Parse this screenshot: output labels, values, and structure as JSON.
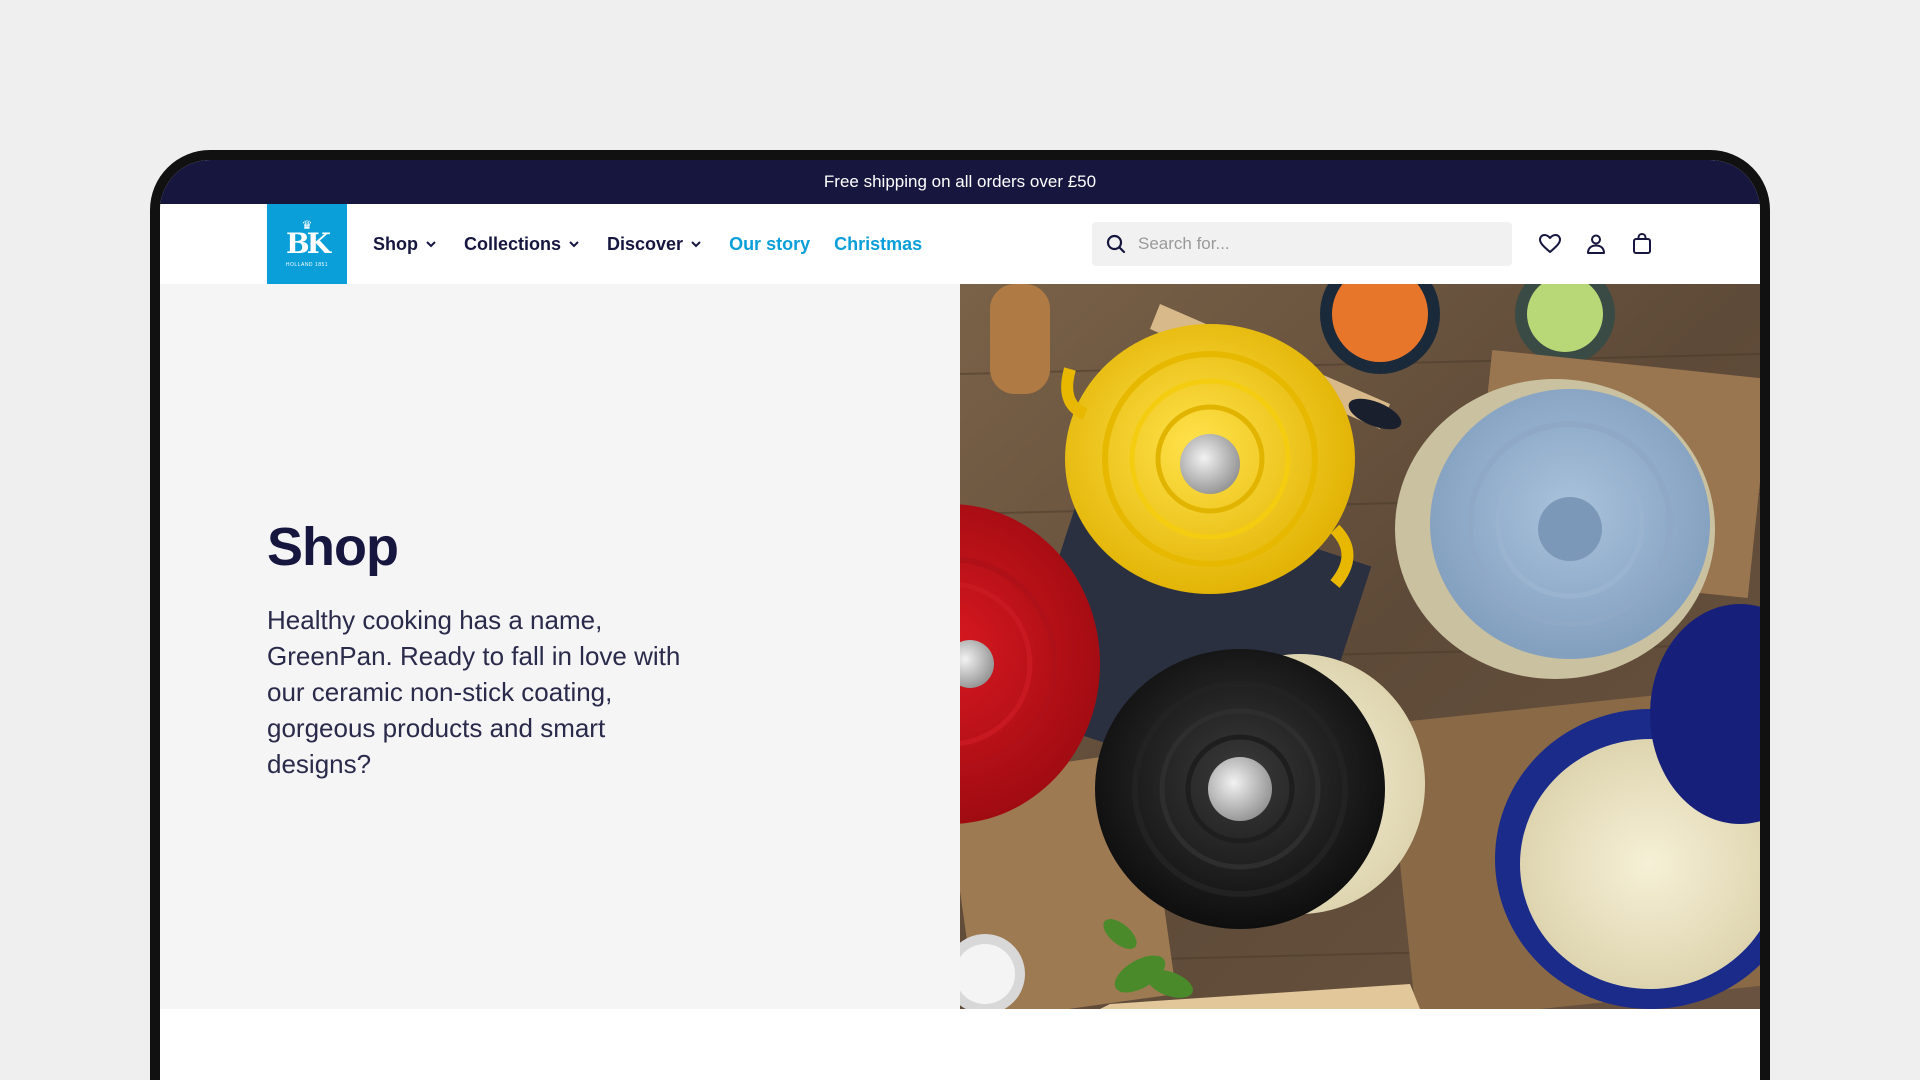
{
  "announcement": "Free shipping on all orders over £50",
  "logo": {
    "mark": "BK",
    "crown": "♛",
    "subtitle": "HOLLAND 1851"
  },
  "nav": {
    "shop": "Shop",
    "collections": "Collections",
    "discover": "Discover",
    "our_story": "Our story",
    "christmas": "Christmas"
  },
  "search": {
    "placeholder": "Search for..."
  },
  "icons": [
    "search-icon",
    "heart-icon",
    "user-icon",
    "bag-icon",
    "chevron-down-icon"
  ],
  "colors": {
    "navy": "#16163f",
    "accent": "#0a9fd8",
    "hero_bg": "#f5f5f6"
  },
  "hero": {
    "title": "Shop",
    "text": "Healthy cooking has a name, GreenPan. Ready to fall in love with our ceramic non-stick coating, gorgeous products and smart designs?"
  }
}
